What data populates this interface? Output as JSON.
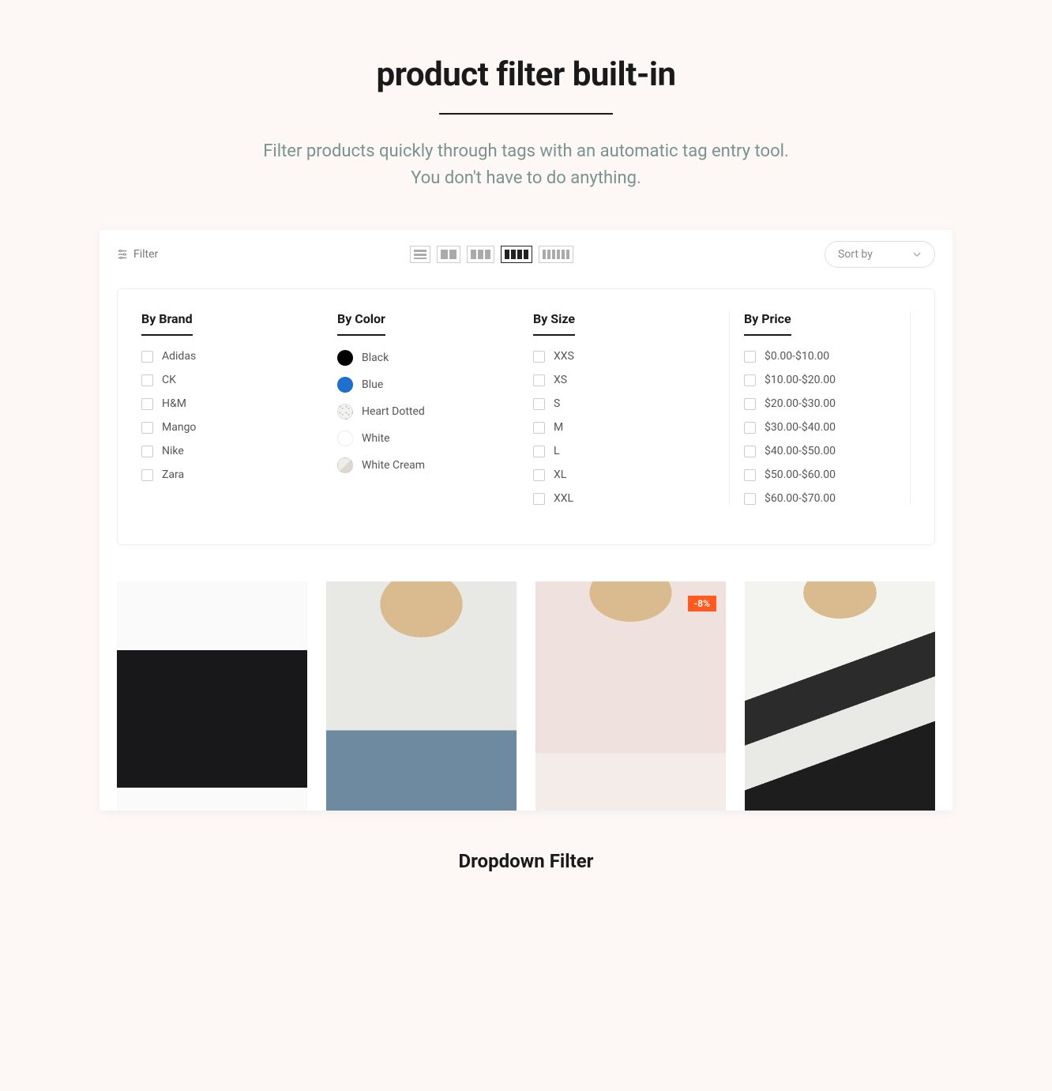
{
  "heading": {
    "title": "product filter built-in",
    "subtitle_line1": "Filter products quickly through tags with an automatic tag entry tool.",
    "subtitle_line2": "You don't have to do anything."
  },
  "toolbar": {
    "filter_label": "Filter",
    "sort_label": "Sort by"
  },
  "filters": {
    "brand": {
      "title": "By Brand",
      "options": [
        "Adidas",
        "CK",
        "H&M",
        "Mango",
        "Nike",
        "Zara"
      ]
    },
    "color": {
      "title": "By Color",
      "options": [
        {
          "label": "Black",
          "swatch": "black"
        },
        {
          "label": "Blue",
          "swatch": "blue"
        },
        {
          "label": "Heart Dotted",
          "swatch": "heart"
        },
        {
          "label": "White",
          "swatch": "white"
        },
        {
          "label": "White Cream",
          "swatch": "cream"
        }
      ]
    },
    "size": {
      "title": "By Size",
      "options": [
        "XXS",
        "XS",
        "S",
        "M",
        "L",
        "XL",
        "XXL"
      ]
    },
    "price": {
      "title": "By Price",
      "options": [
        "$0.00-$10.00",
        "$10.00-$20.00",
        "$20.00-$30.00",
        "$30.00-$40.00",
        "$40.00-$50.00",
        "$50.00-$60.00",
        "$60.00-$70.00"
      ]
    }
  },
  "products": {
    "badge_3": "-8%"
  },
  "caption": "Dropdown Filter"
}
